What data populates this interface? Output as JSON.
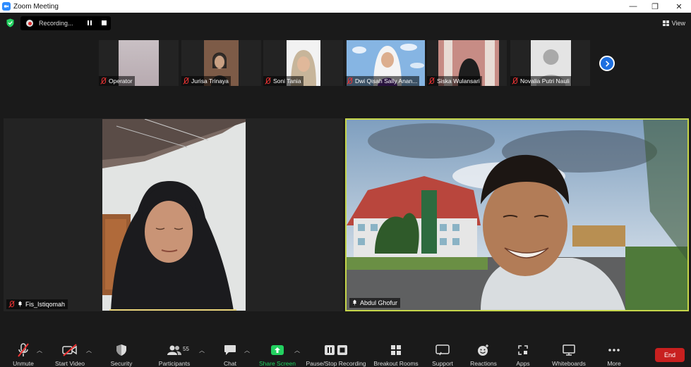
{
  "window": {
    "title": "Zoom Meeting",
    "controls": [
      "—",
      "❐",
      "✕"
    ]
  },
  "recording": {
    "status": "Recording..."
  },
  "view_button": {
    "label": "View"
  },
  "thumbnails": [
    {
      "name": "Operator",
      "muted": true
    },
    {
      "name": "Jurisa Trinaya",
      "muted": true
    },
    {
      "name": "Soni Tania",
      "muted": true
    },
    {
      "name": "Dwi Qisah Sally Anan...",
      "muted": true
    },
    {
      "name": "Siska Wulansari",
      "muted": true
    },
    {
      "name": "Novalia Putri Nauli",
      "muted": true
    }
  ],
  "speakers": {
    "left": {
      "name": "Fis_Istiqomah",
      "muted": true,
      "pinned": true
    },
    "right": {
      "name": "Abdul Ghofur",
      "pinned": true
    }
  },
  "toolbar": {
    "unmute": "Unmute",
    "start_video": "Start Video",
    "security": "Security",
    "participants": "Participants",
    "participants_count": "55",
    "chat": "Chat",
    "share_screen": "Share Screen",
    "pause_stop_recording": "Pause/Stop Recording",
    "breakout_rooms": "Breakout Rooms",
    "support": "Support",
    "reactions": "Reactions",
    "apps": "Apps",
    "whiteboards": "Whiteboards",
    "more": "More",
    "end": "End"
  },
  "colors": {
    "share_green": "#23d160",
    "end_red": "#c8201f",
    "active_speaker_border": "#c6d64a",
    "mute_red": "#e33333",
    "accent_blue": "#2d8cff"
  },
  "icons": {
    "shield": "shield-check-icon",
    "next": "chevron-right-icon",
    "mute": "microphone-muted-icon",
    "pin": "pin-icon"
  }
}
